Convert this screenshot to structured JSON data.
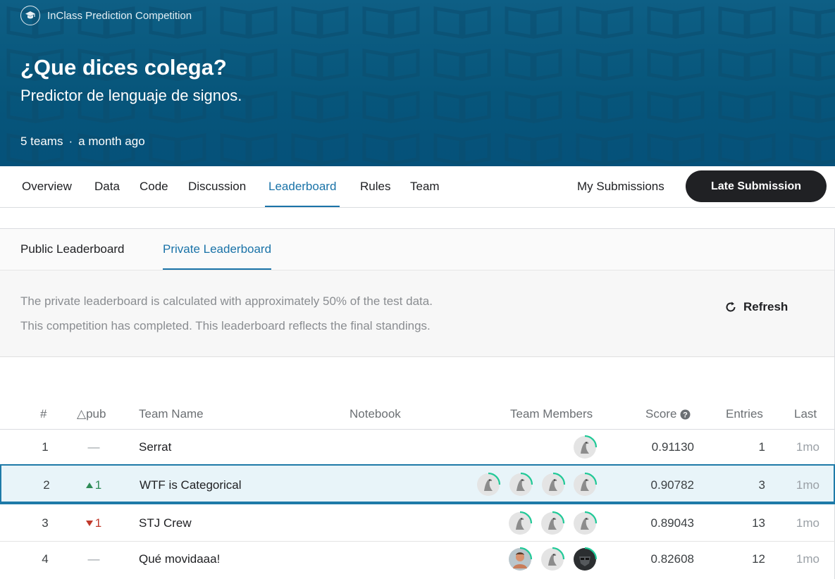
{
  "competition": {
    "type_label": "InClass Prediction Competition",
    "title": "¿Que dices colega?",
    "subtitle": "Predictor de lenguaje de signos.",
    "teams": "5 teams",
    "separator": "·",
    "time": "a month ago"
  },
  "nav": {
    "tabs": [
      "Overview",
      "Data",
      "Code",
      "Discussion",
      "Leaderboard",
      "Rules",
      "Team"
    ],
    "active": "Leaderboard",
    "my_submissions": "My Submissions",
    "late_submission": "Late Submission"
  },
  "leaderboard": {
    "tabs": [
      "Public Leaderboard",
      "Private Leaderboard"
    ],
    "active": "Private Leaderboard",
    "info_line1": "The private leaderboard is calculated with approximately 50% of the test data.",
    "info_line2": "This competition has completed. This leaderboard reflects the final standings.",
    "refresh_label": "Refresh",
    "columns": {
      "rank": "#",
      "delta": "△pub",
      "team_name": "Team Name",
      "notebook": "Notebook",
      "members": "Team Members",
      "score": "Score",
      "entries": "Entries",
      "last": "Last"
    },
    "rows": [
      {
        "rank": "1",
        "delta": "—",
        "delta_dir": "none",
        "team": "Serrat",
        "members": [
          "goose"
        ],
        "score": "0.91130",
        "entries": "1",
        "last": "1mo"
      },
      {
        "rank": "2",
        "delta": "1",
        "delta_dir": "up",
        "team": "WTF is Categorical",
        "members": [
          "goose",
          "goose",
          "goose",
          "goose"
        ],
        "score": "0.90782",
        "entries": "3",
        "last": "1mo"
      },
      {
        "rank": "3",
        "delta": "1",
        "delta_dir": "down",
        "team": "STJ Crew",
        "members": [
          "goose",
          "goose",
          "goose"
        ],
        "score": "0.89043",
        "entries": "13",
        "last": "1mo"
      },
      {
        "rank": "4",
        "delta": "—",
        "delta_dir": "none",
        "team": "Qué movidaaa!",
        "members": [
          "photo",
          "goose",
          "mask"
        ],
        "score": "0.82608",
        "entries": "12",
        "last": "1mo"
      }
    ]
  },
  "colors": {
    "banner": "#07567b",
    "accent": "#1a73a8",
    "up": "#2e8b57",
    "down": "#c0392b",
    "ring": "#20c997"
  }
}
